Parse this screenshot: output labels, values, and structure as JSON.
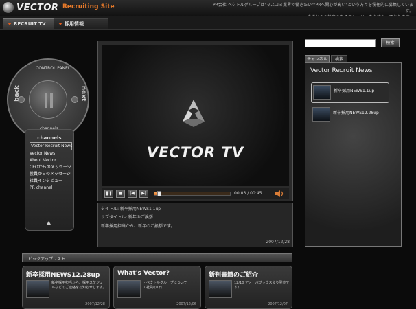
{
  "header": {
    "logo_text": "VECTOR",
    "site_label": "Recruiting Site",
    "note_line1": "PR会社 ベクトルグループは\"マスコミ業界で働きたい\"\"PRへ関心が高い\"という方々を積極的に募集しています。",
    "note_line2": "皆様からの熱意のあるエントリーをお待ちしております。"
  },
  "nav": {
    "tab1": "RECRUIT TV",
    "tab2": "採用情報"
  },
  "control_panel": {
    "label_top": "CONTROL PANEL",
    "label_bottom": "channels",
    "back": "back",
    "next": "next"
  },
  "channels": {
    "title": "channels",
    "items": [
      "Vector Recruit News",
      "Vector News",
      "About Vector",
      "CEOからのメッセージ",
      "役員からのメッセージ",
      "社員インタビュー",
      "PR channel"
    ]
  },
  "video": {
    "title_text": "VECTOR TV",
    "time": "00:03 / 00:45",
    "progress": 0.06
  },
  "info": {
    "title": "タイトル: 新卒採用NEWS1.1up",
    "subtitle": "サブタイトル: 新年のご挨拶",
    "desc": "新卒採用担当から、新年のご挨拶です。",
    "date": "2007/12/28"
  },
  "search": {
    "placeholder": "",
    "button": "検索"
  },
  "right_tabs": {
    "tab1": "チャンネル",
    "tab2": "検索"
  },
  "right_panel": {
    "title": "Vector Recruit News",
    "items": [
      "新卒採用NEWS1.1up",
      "新卒採用NEWS12.28up"
    ]
  },
  "pickup": {
    "title": "ピックアップリスト",
    "cards": [
      {
        "title": "新卒採用NEWS12.28up",
        "desc": "新卒採用担当から、採用スケジュールなどのご連絡をお知らせします。",
        "date": "2007/12/28"
      },
      {
        "title": "What's Vector?",
        "desc": "・ベクトルグループについて\n・社員の1日",
        "date": "2007/12/06"
      },
      {
        "title": "新刊書籍のご紹介",
        "desc": "12/10 アメーバブックスより発売です！",
        "date": "2007/12/07"
      }
    ]
  }
}
